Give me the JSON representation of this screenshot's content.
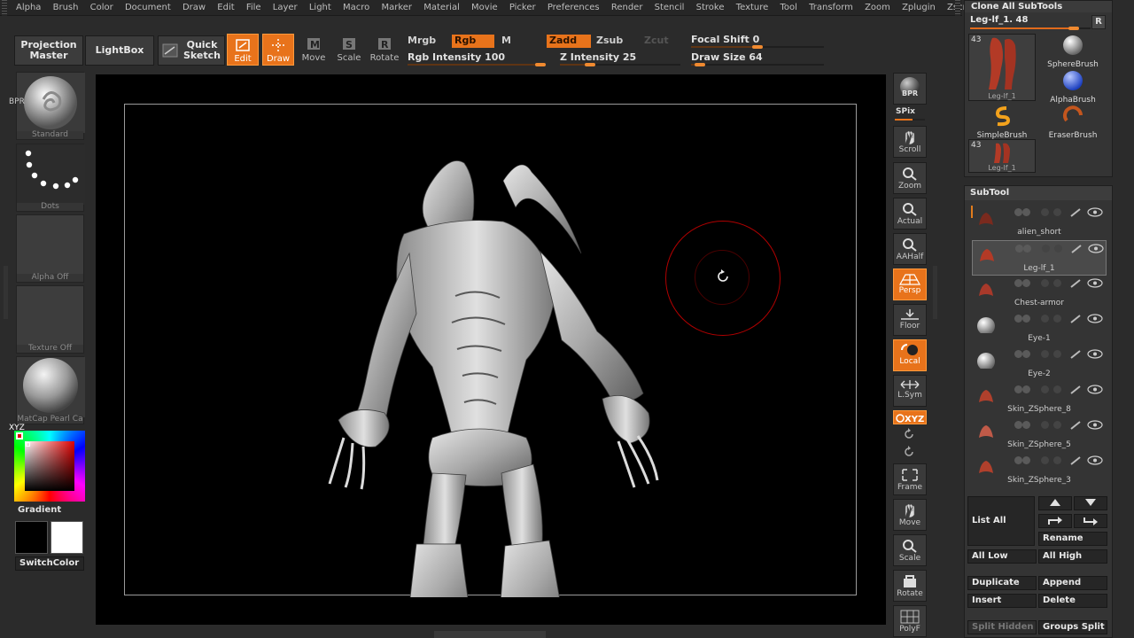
{
  "menu": [
    "Alpha",
    "Brush",
    "Color",
    "Document",
    "Draw",
    "Edit",
    "File",
    "Layer",
    "Light",
    "Macro",
    "Marker",
    "Material",
    "Movie",
    "Picker",
    "Preferences",
    "Render",
    "Stencil",
    "Stroke",
    "Texture",
    "Tool",
    "Transform",
    "Zoom",
    "Zplugin",
    "Zscript"
  ],
  "toolbar": {
    "projection_master": [
      "Projection",
      "Master"
    ],
    "lightbox": "LightBox",
    "quick_sketch": [
      "Quick",
      "Sketch"
    ],
    "tools": [
      {
        "label": "Edit",
        "on": true,
        "icon": "edit-icon"
      },
      {
        "label": "Draw",
        "on": true,
        "icon": "draw-icon"
      },
      {
        "label": "Move",
        "on": false,
        "icon": "move-icon"
      },
      {
        "label": "Scale",
        "on": false,
        "icon": "scale-icon"
      },
      {
        "label": "Rotate",
        "on": false,
        "icon": "rotate-icon"
      }
    ],
    "mrgb": "Mrgb",
    "rgb": "Rgb",
    "m": "M",
    "zadd": "Zadd",
    "zsub": "Zsub",
    "zcut": "Zcut",
    "rgb_intensity": {
      "label": "Rgb Intensity 100",
      "value": 100,
      "max": 100
    },
    "z_intensity": {
      "label": "Z Intensity 25",
      "value": 25,
      "max": 100
    },
    "focal_shift": {
      "label": "Focal Shift 0",
      "value": 0,
      "min": -100,
      "max": 100
    },
    "draw_size": {
      "label": "Draw Size 64",
      "value": 64,
      "max": 1000
    }
  },
  "left_panel": {
    "brush_caption": "Standard",
    "stroke_caption": "Dots",
    "alpha_caption": "Alpha Off",
    "texture_caption": "Texture Off",
    "material_caption": "MatCap Pearl Ca",
    "gradient_label": "Gradient",
    "switch_color": "SwitchColor",
    "main_color": "#e00000",
    "secondary_color": "#000000",
    "tertiary_color": "#ffffff"
  },
  "right_shelf": [
    {
      "label": "BPR",
      "icon": "bpr-icon",
      "on": false
    },
    {
      "label": "SPix",
      "icon": "spix-slider",
      "on": false
    },
    {
      "label": "Scroll",
      "icon": "scroll-icon",
      "on": false
    },
    {
      "label": "Zoom",
      "icon": "zoom-icon",
      "on": false
    },
    {
      "label": "Actual",
      "icon": "actual-icon",
      "on": false
    },
    {
      "label": "AAHalf",
      "icon": "aahalf-icon",
      "on": false
    },
    {
      "label": "Persp",
      "icon": "persp-icon",
      "on": true
    },
    {
      "label": "Floor",
      "icon": "floor-icon",
      "on": false
    },
    {
      "label": "Local",
      "icon": "local-icon",
      "on": true
    },
    {
      "label": "L.Sym",
      "icon": "lsym-icon",
      "on": false
    },
    {
      "label": "XYZ",
      "icon": "xyz-icon",
      "on": true
    },
    {
      "label": "Frame",
      "icon": "frame-icon",
      "on": false
    },
    {
      "label": "Move",
      "icon": "move-icon",
      "on": false
    },
    {
      "label": "Scale",
      "icon": "scale-icon",
      "on": false
    },
    {
      "label": "Rotate",
      "icon": "rotate-icon",
      "on": false
    },
    {
      "label": "PolyF",
      "icon": "polyf-icon",
      "on": false
    }
  ],
  "clone_panel": {
    "title": "Clone All SubTools",
    "current_tool": {
      "label": "Leg-lf_1. 48",
      "value": 48,
      "max": 56
    },
    "r_button": "R",
    "current_thumb": {
      "count": "43",
      "caption": "Leg-lf_1"
    },
    "brushes": [
      "SphereBrush",
      "AlphaBrush",
      "SimpleBrush",
      "EraserBrush"
    ],
    "second_thumb": {
      "count": "43",
      "caption": "Leg-lf_1"
    }
  },
  "subtool": {
    "title": "SubTool",
    "items": [
      "alien_short",
      "Leg-lf_1",
      "Chest-armor",
      "Eye-1",
      "Eye-2",
      "Skin_ZSphere_8",
      "Skin_ZSphere_5",
      "Skin_ZSphere_3"
    ],
    "active_index": 1,
    "list_all": "List All",
    "rename": "Rename",
    "all_low": "All Low",
    "all_high": "All High",
    "duplicate": "Duplicate",
    "append": "Append",
    "insert": "Insert",
    "delete": "Delete",
    "split_hidden": "Split Hidden",
    "groups_split": "Groups Split"
  }
}
